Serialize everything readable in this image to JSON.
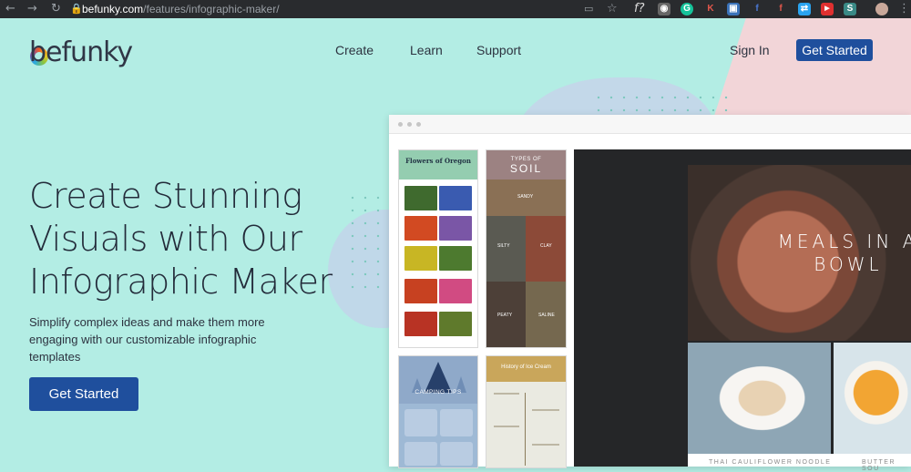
{
  "browser": {
    "url_host": "befunky.com",
    "url_path": "/features/infographic-maker/"
  },
  "header": {
    "logo": "befunky",
    "nav": [
      "Create",
      "Learn",
      "Support"
    ],
    "sign_in": "Sign In",
    "cta": "Get Started"
  },
  "hero": {
    "title_lines": [
      "Create Stunning",
      "Visuals with Our",
      "Infographic Maker"
    ],
    "subtitle": "Simplify complex ideas and make them more engaging with our customizable infographic templates",
    "cta": "Get Started"
  },
  "templates": {
    "flowers_title": "Flowers of Oregon",
    "soil_small": "TYPES OF",
    "soil_big": "SOIL",
    "soil_labels": [
      "SANDY",
      "SILTY",
      "CLAY",
      "PEATY",
      "SALINE"
    ],
    "camping_title": "CAMPING TIPS",
    "icecream_title": "History of Ice Cream",
    "meals_title": "MEALS IN A BOWL",
    "noodle_caption": "THAI CAULIFLOWER NOODLE",
    "soup_caption": "BUTTER SOU"
  },
  "colors": {
    "background": "#b3ede4",
    "primary_button": "#1f4f9d",
    "text": "#232b3a"
  }
}
